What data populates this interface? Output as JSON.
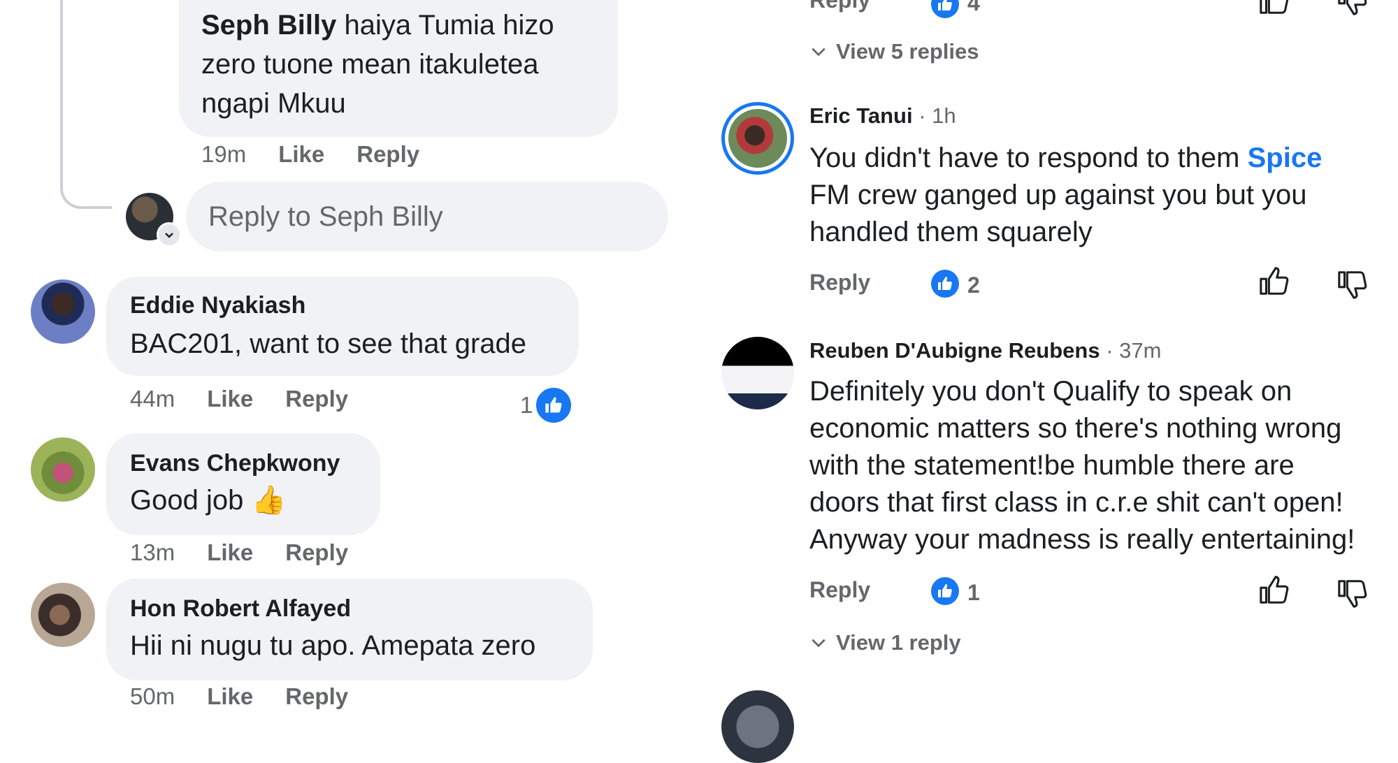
{
  "left": {
    "reply_thread": {
      "author": "Seph Billy",
      "text_line1": "haiya Tumia hizo",
      "text_line2": "zero tuone mean itakuletea",
      "text_line3": "ngapi Mkuu",
      "time": "19m",
      "like": "Like",
      "reply": "Reply"
    },
    "reply_input": {
      "placeholder": "Reply to Seph Billy"
    },
    "comments": [
      {
        "author": "Eddie Nyakiash",
        "text": "BAC201, want to see that grade",
        "time": "44m",
        "like": "Like",
        "reply": "Reply",
        "reactions": "1"
      },
      {
        "author": "Evans Chepkwony",
        "text": "Good job 👍",
        "time": "13m",
        "like": "Like",
        "reply": "Reply"
      },
      {
        "author": "Hon Robert Alfayed",
        "text": "Hii ni nugu tu apo. Amepata zero",
        "time": "50m",
        "like": "Like",
        "reply": "Reply"
      }
    ]
  },
  "right": {
    "top": {
      "reply": "Reply",
      "likes": "4",
      "view_replies": "View 5 replies"
    },
    "comments": [
      {
        "author": "Eric Tanui",
        "time": "· 1h",
        "line1_pre": "You didn't have to respond to them",
        "line1_link": "Spice",
        "line2": "FM crew ganged  up against you but you",
        "line3": "handled them squarely",
        "reply": "Reply",
        "likes": "2"
      },
      {
        "author": "Reuben D'Aubigne Reubens",
        "time": "· 37m",
        "line1": "Definitely you don't Qualify to speak on",
        "line2": "economic matters so there's nothing wrong",
        "line3": "with the statement!be humble there are",
        "line4": "doors that first class in c.r.e shit can't open!",
        "line5": "Anyway your madness is really entertaining!",
        "reply": "Reply",
        "likes": "1",
        "view_replies": "View 1 reply"
      }
    ]
  },
  "colors": {
    "accent": "#1877f2",
    "bubble": "#f0f2f5",
    "muted": "#65676b"
  }
}
